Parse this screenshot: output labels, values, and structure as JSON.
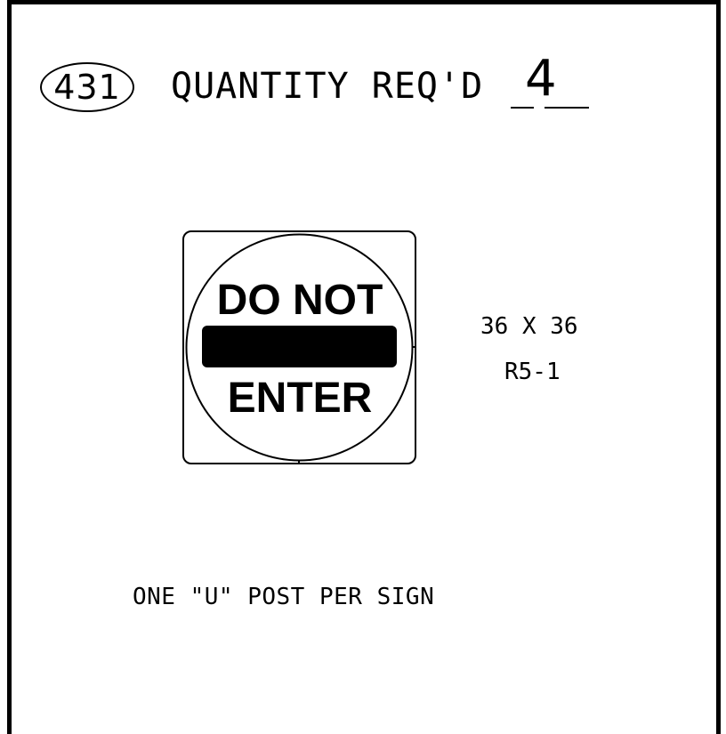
{
  "sheet": {
    "number": "431",
    "quantity_label": "QUANTITY REQ'D",
    "quantity_value": "4"
  },
  "sign": {
    "text_top": "DO NOT",
    "text_bottom": "ENTER",
    "size": "36 X 36",
    "code": "R5-1"
  },
  "notes": {
    "post": "ONE \"U\" POST PER SIGN"
  },
  "colors": {
    "ink": "#000000",
    "background": "#ffffff"
  }
}
